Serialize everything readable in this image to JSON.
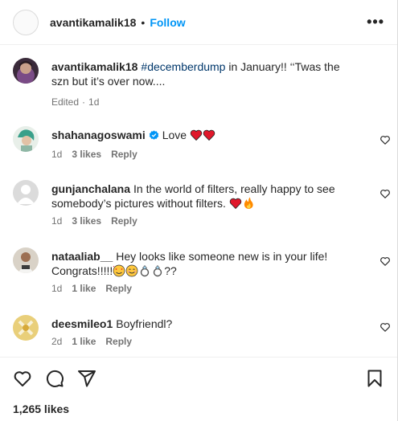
{
  "header": {
    "username": "avantikamalik18",
    "separator": "•",
    "follow_label": "Follow",
    "more_label": "•••"
  },
  "caption": {
    "username": "avantikamalik18",
    "hashtag": "#decemberdump",
    "text": "in January!! ‘‘Twas the szn but it’s over now....",
    "edited": "Edited",
    "separator": "·",
    "time": "1d"
  },
  "comments": [
    {
      "username": "shahanagoswami",
      "verified": true,
      "text": "Love",
      "emojis": [
        "heart",
        "heart"
      ],
      "time": "1d",
      "likes": "3 likes",
      "reply": "Reply"
    },
    {
      "username": "gunjanchalana",
      "verified": false,
      "text": "In the world of filters, really happy to see somebody’s pictures without filters.",
      "emojis": [
        "heart",
        "fire"
      ],
      "time": "1d",
      "likes": "3 likes",
      "reply": "Reply"
    },
    {
      "username": "nataaliab__",
      "verified": false,
      "text": "Hey looks like someone new is in your life! Congrats!!!!!",
      "emojis": [
        "smiling-face-hearts",
        "smiling-face",
        "ring",
        "ring"
      ],
      "suffix": "??",
      "time": "1d",
      "likes": "1 like",
      "reply": "Reply"
    },
    {
      "username": "deesmileo1",
      "verified": false,
      "text": "Boyfriendl?",
      "emojis": [],
      "time": "2d",
      "likes": "1 like",
      "reply": "Reply"
    }
  ],
  "actions": {
    "icons": [
      "heart-icon",
      "comment-icon",
      "share-icon",
      "bookmark-icon"
    ],
    "likes_count": "1,265 likes"
  },
  "colors": {
    "accent": "#0095f6",
    "hashtag": "#00376b",
    "text": "#262626",
    "secondary": "#737373",
    "heart": "#ed4956"
  }
}
